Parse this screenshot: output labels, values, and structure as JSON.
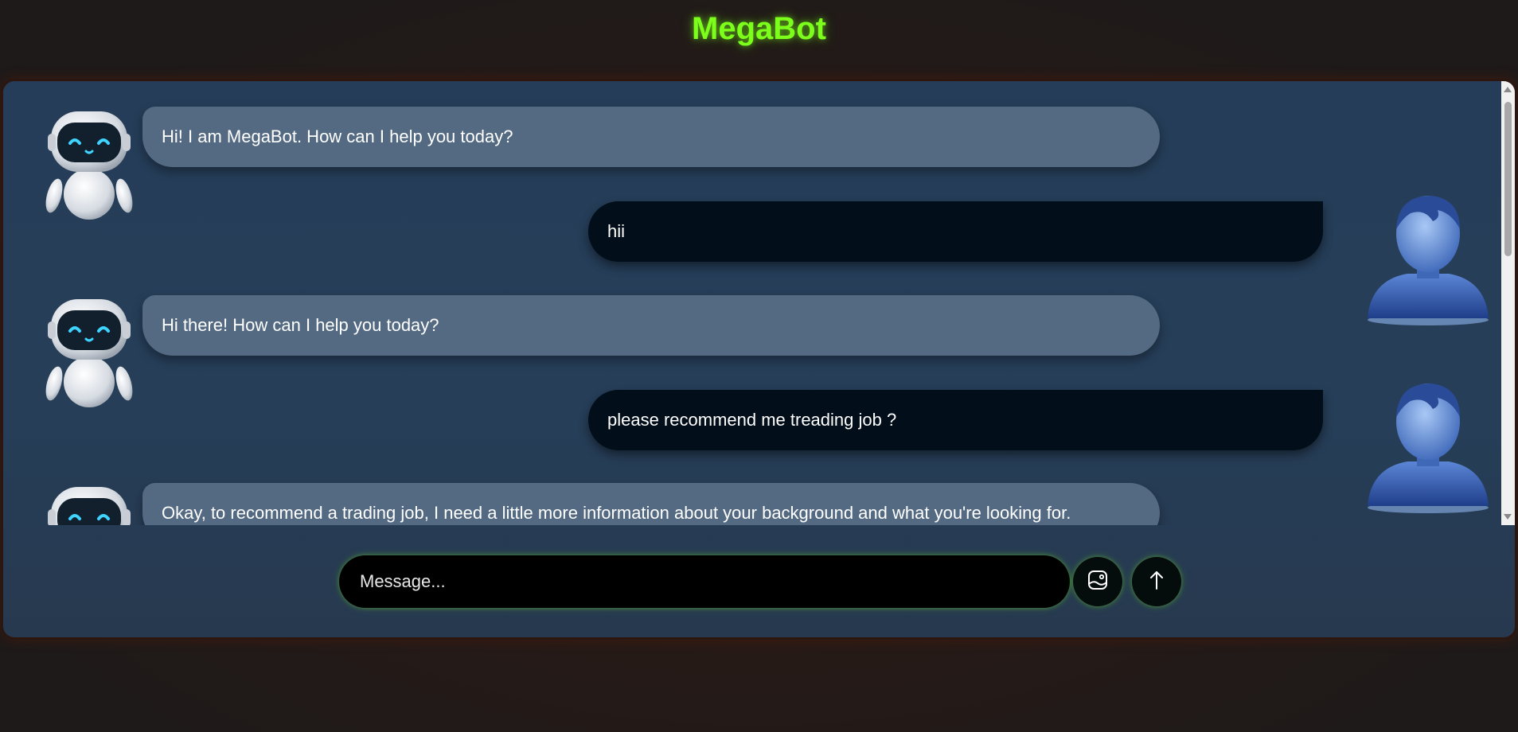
{
  "app": {
    "title": "MegaBot"
  },
  "messages": [
    {
      "sender": "bot",
      "text": "Hi! I am MegaBot. How can I help you today?"
    },
    {
      "sender": "user",
      "text": "hii"
    },
    {
      "sender": "bot",
      "text": "Hi there! How can I help you today?"
    },
    {
      "sender": "user",
      "text": "please recommend me treading job ?"
    },
    {
      "sender": "bot",
      "text": "Okay, to recommend a trading job, I need a little more information about your background and what you're looking for."
    }
  ],
  "composer": {
    "placeholder": "Message...",
    "value": "",
    "attach_icon": "image-upload-icon",
    "send_icon": "arrow-up-icon"
  },
  "colors": {
    "title": "#7cff1a",
    "bot_bubble": "#536a82",
    "user_bubble": "#020e19",
    "panel": "#253d58",
    "input": "#000000"
  }
}
